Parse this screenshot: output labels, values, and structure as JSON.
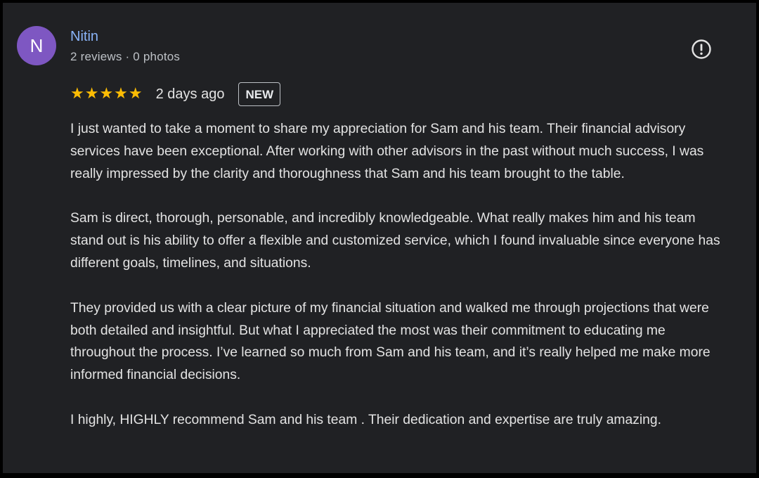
{
  "reviewer": {
    "initial": "N",
    "name": "Nitin",
    "meta": "2 reviews · 0 photos",
    "avatar_color": "#7e57c2"
  },
  "review": {
    "stars": "★★★★★",
    "rating": 5,
    "date": "2 days ago",
    "badge": "NEW",
    "paragraphs": [
      "I just wanted to take a moment to share my appreciation for Sam and his team. Their financial advisory services have been exceptional. After working with other advisors in the past without much success, I was really impressed by the clarity and thoroughness that Sam and his team brought to the table.",
      "Sam is direct, thorough, personable, and incredibly knowledgeable. What really makes him and his team stand out is his ability to offer a flexible and customized service, which I found invaluable since everyone has different goals, timelines, and situations.",
      "They provided us with a clear picture of my financial situation and walked me through projections that were both detailed and insightful. But what I appreciated the most was their commitment to educating me throughout the process. I’ve learned so much from Sam and his team, and it’s really helped me make more informed financial decisions.",
      "I highly, HIGHLY recommend Sam and his team . Their dedication and expertise are truly amazing."
    ]
  },
  "icons": {
    "report": "report-flag-icon"
  },
  "colors": {
    "background": "#202124",
    "name_link": "#8ab4f8",
    "star": "#fbbc04",
    "text": "#e3e3e3"
  }
}
